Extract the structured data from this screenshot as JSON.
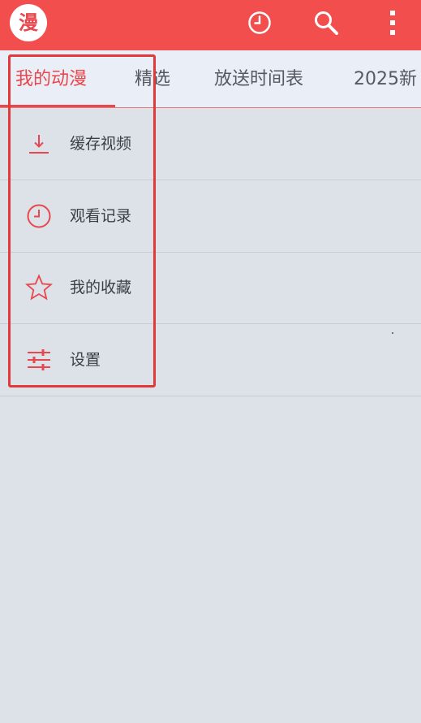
{
  "app": {
    "logo_text": "漫",
    "brand_color": "#f24e4e"
  },
  "appbar": {
    "icons": [
      "history-icon",
      "search-icon",
      "more-vert-icon"
    ]
  },
  "tabs": [
    {
      "label": "我的动漫",
      "active": true
    },
    {
      "label": "精选",
      "active": false
    },
    {
      "label": "放送时间表",
      "active": false
    },
    {
      "label": "2025新",
      "active": false
    }
  ],
  "menu": {
    "items": [
      {
        "label": "缓存视频",
        "icon": "download-icon"
      },
      {
        "label": "观看记录",
        "icon": "clock-icon"
      },
      {
        "label": "我的收藏",
        "icon": "star-icon"
      },
      {
        "label": "设置",
        "icon": "sliders-icon"
      }
    ]
  },
  "colors": {
    "accent": "#e8474d",
    "background": "#dde2e9",
    "tab_background": "#eaeef6"
  }
}
